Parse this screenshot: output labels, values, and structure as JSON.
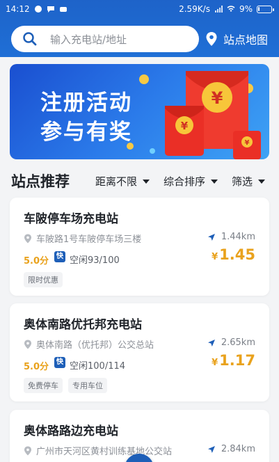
{
  "status_bar": {
    "time": "14:12",
    "speed": "2.59K/s",
    "battery_percent": "9%",
    "battery_level": 0.09
  },
  "search": {
    "placeholder": "输入充电站/地址"
  },
  "map_link": {
    "label": "站点地图"
  },
  "banner": {
    "line1": "注册活动",
    "line2": "参与有奖"
  },
  "section": {
    "title": "站点推荐",
    "filters": [
      {
        "label": "距离不限"
      },
      {
        "label": "综合排序"
      },
      {
        "label": "筛选"
      }
    ]
  },
  "stations": [
    {
      "name": "车陂停车场充电站",
      "address": "车陂路1号车陂停车场三楼",
      "distance": "1.44km",
      "score": "5.0分",
      "fast_label": "快",
      "idle": "空闲93/100",
      "currency": "¥",
      "price": "1.45",
      "tags": [
        "限时优惠"
      ]
    },
    {
      "name": "奥体南路优托邦充电站",
      "address": "奥体南路（优托邦）公交总站",
      "distance": "2.65km",
      "score": "5.0分",
      "fast_label": "快",
      "idle": "空闲100/114",
      "currency": "¥",
      "price": "1.17",
      "tags": [
        "免费停车",
        "专用车位"
      ]
    },
    {
      "name": "奥体路路边充电站",
      "address": "广州市天河区黄村训练基地公交站",
      "distance": "2.84km"
    }
  ],
  "colors": {
    "brand_blue": "#1f6fd6",
    "price_gold": "#e9a21d"
  }
}
